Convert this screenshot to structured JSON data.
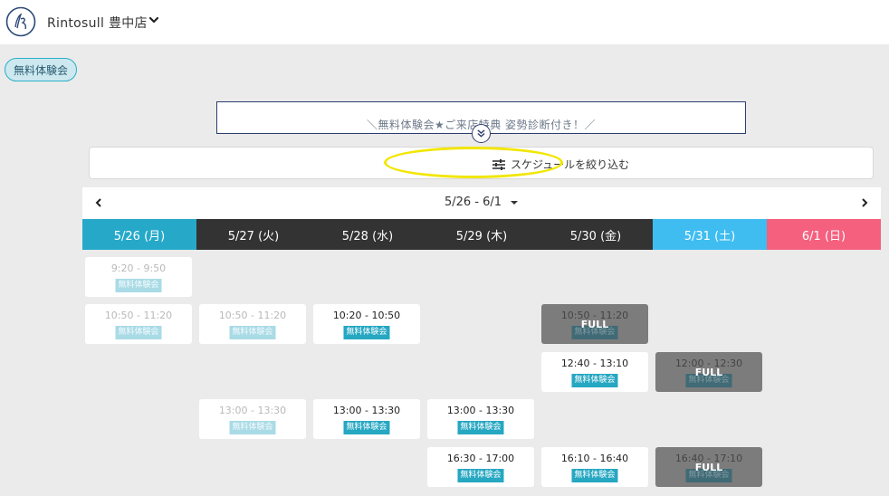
{
  "header": {
    "store_name": "Rintosull 豊中店",
    "logo_icon": "rintosull-logo",
    "dropdown_icon": "chevron-down-icon"
  },
  "menu_chip": {
    "label": "無料体験会"
  },
  "banner": {
    "text": "＼無料体験会★ご来店特典 姿勢診断付き！／",
    "toggle_icon": "double-chevron-down-icon"
  },
  "filter": {
    "label": "スケジュールを絞り込む",
    "icon": "sliders-icon"
  },
  "week_nav": {
    "range": "5/26 - 6/1",
    "prev_icon": "chevron-left-icon",
    "next_icon": "chevron-right-icon",
    "caret_icon": "caret-down-icon"
  },
  "days": [
    {
      "label": "5/26 (月)",
      "color": "#26a9c9"
    },
    {
      "label": "5/27 (火)",
      "color": "#333333"
    },
    {
      "label": "5/28 (水)",
      "color": "#333333"
    },
    {
      "label": "5/29 (木)",
      "color": "#333333"
    },
    {
      "label": "5/30 (金)",
      "color": "#333333"
    },
    {
      "label": "5/31 (土)",
      "color": "#3fbdf0"
    },
    {
      "label": "6/1 (日)",
      "color": "#f5607f"
    }
  ],
  "slots": [
    {
      "day": 0,
      "row": 0,
      "time": "9:20 - 9:50",
      "badge": "無料体験会",
      "state": "past"
    },
    {
      "day": 0,
      "row": 1,
      "time": "10:50 - 11:20",
      "badge": "無料体験会",
      "state": "past"
    },
    {
      "day": 1,
      "row": 1,
      "time": "10:50 - 11:20",
      "badge": "無料体験会",
      "state": "past"
    },
    {
      "day": 2,
      "row": 1,
      "time": "10:20 - 10:50",
      "badge": "無料体験会",
      "state": "open"
    },
    {
      "day": 4,
      "row": 1,
      "time": "10:50 - 11:20",
      "badge": "無料体験会",
      "state": "full",
      "full_label": "FULL"
    },
    {
      "day": 4,
      "row": 2,
      "time": "12:40 - 13:10",
      "badge": "無料体験会",
      "state": "open"
    },
    {
      "day": 5,
      "row": 2,
      "time": "12:00 - 12:30",
      "badge": "無料体験会",
      "state": "full",
      "full_label": "FULL"
    },
    {
      "day": 1,
      "row": 3,
      "time": "13:00 - 13:30",
      "badge": "無料体験会",
      "state": "past"
    },
    {
      "day": 2,
      "row": 3,
      "time": "13:00 - 13:30",
      "badge": "無料体験会",
      "state": "open"
    },
    {
      "day": 3,
      "row": 3,
      "time": "13:00 - 13:30",
      "badge": "無料体験会",
      "state": "open"
    },
    {
      "day": 3,
      "row": 4,
      "time": "16:30 - 17:00",
      "badge": "無料体験会",
      "state": "open"
    },
    {
      "day": 4,
      "row": 4,
      "time": "16:10 - 16:40",
      "badge": "無料体験会",
      "state": "open"
    },
    {
      "day": 5,
      "row": 4,
      "time": "16:40 - 17:10",
      "badge": "無料体験会",
      "state": "full",
      "full_label": "FULL"
    }
  ]
}
